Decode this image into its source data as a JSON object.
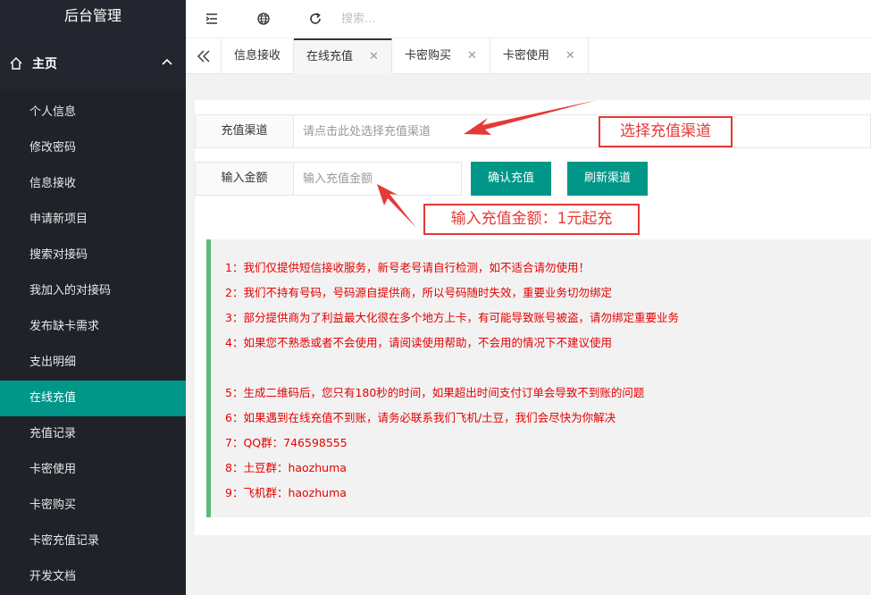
{
  "sidebar": {
    "title": "后台管理",
    "home_label": "主页",
    "items": [
      {
        "label": "个人信息"
      },
      {
        "label": "修改密码"
      },
      {
        "label": "信息接收"
      },
      {
        "label": "申请新项目"
      },
      {
        "label": "搜索对接码"
      },
      {
        "label": "我加入的对接码"
      },
      {
        "label": "发布缺卡需求"
      },
      {
        "label": "支出明细"
      },
      {
        "label": "在线充值",
        "active": true
      },
      {
        "label": "充值记录"
      },
      {
        "label": "卡密使用"
      },
      {
        "label": "卡密购买"
      },
      {
        "label": "卡密充值记录"
      },
      {
        "label": "开发文档"
      }
    ]
  },
  "topbar": {
    "search_placeholder": "搜索..."
  },
  "tabs": [
    {
      "label": "信息接收",
      "closable": false
    },
    {
      "label": "在线充值",
      "closable": true,
      "active": true
    },
    {
      "label": "卡密购买",
      "closable": true
    },
    {
      "label": "卡密使用",
      "closable": true
    }
  ],
  "form": {
    "channel_label": "充值渠道",
    "channel_placeholder": "请点击此处选择充值渠道",
    "amount_label": "输入金额",
    "amount_placeholder": "输入充值金额",
    "confirm_button": "确认充值",
    "refresh_button": "刷新渠道"
  },
  "notices": [
    "1：我们仅提供短信接收服务，新号老号请自行检测，如不适合请勿使用！",
    "2：我们不持有号码，号码源自提供商，所以号码随时失效，重要业务切勿绑定",
    "3：部分提供商为了利益最大化很在多个地方上卡，有可能导致账号被盗，请勿绑定重要业务",
    "4：如果您不熟悉或者不会使用，请阅读使用帮助，不会用的情况下不建议使用",
    "",
    "5：生成二维码后，您只有180秒的时间，如果超出时间支付订单会导致不到账的问题",
    "6：如果遇到在线充值不到账，请务必联系我们飞机/土豆，我们会尽快为你解决",
    "7：QQ群：746598555",
    "8：土豆群：haozhuma",
    "9：飞机群：haozhuma"
  ],
  "annotations": {
    "channel_note": "选择充值渠道",
    "amount_note": "输入充值金额：1元起充"
  },
  "colors": {
    "accent": "#009688",
    "sidebar_bg": "#282b33",
    "notice_text": "#e50000",
    "notice_border": "#5fb878",
    "annotation": "#e53935"
  }
}
